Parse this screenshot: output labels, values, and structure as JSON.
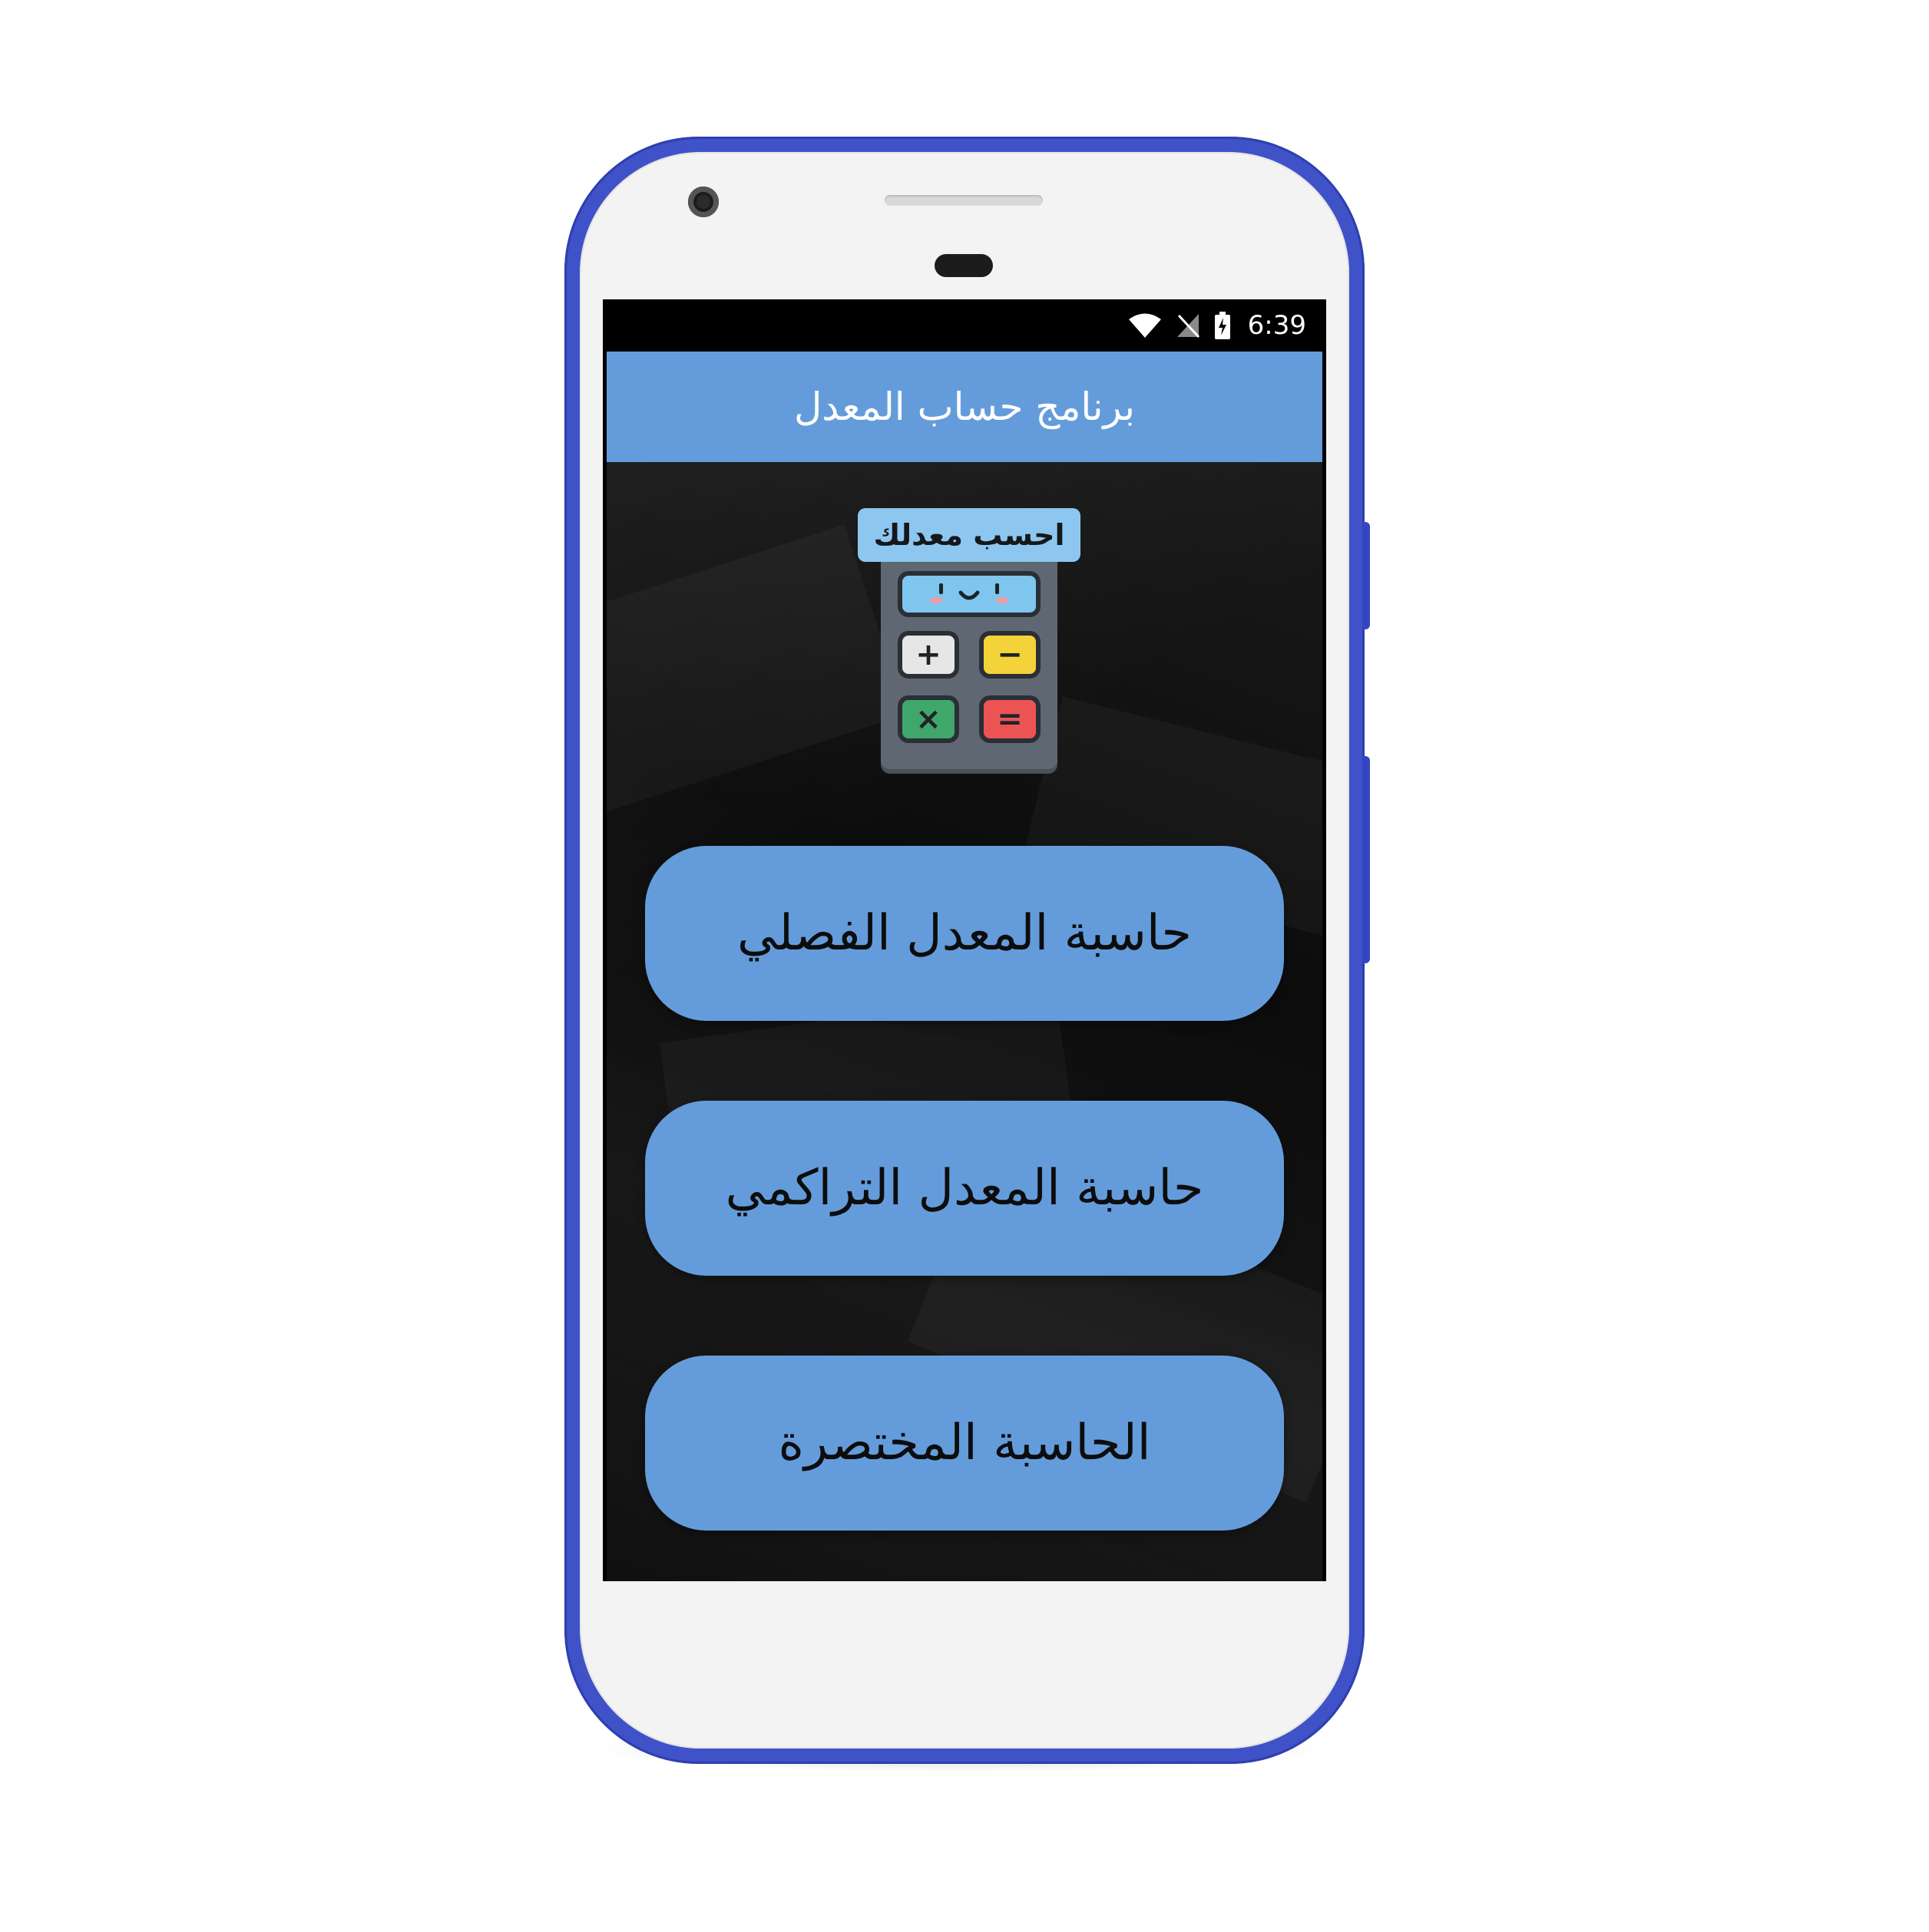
{
  "status_bar": {
    "time": "6:39",
    "icons": [
      "wifi-icon",
      "no-sim-icon",
      "battery-charging-icon"
    ]
  },
  "app_bar": {
    "title": "برنامج حساب المعدل"
  },
  "logo": {
    "label": "احسب معدلك",
    "keys": {
      "plus": "+",
      "minus": "−",
      "times": "×",
      "equals": "="
    }
  },
  "menu": {
    "semester_calculator": "حاسبة المعدل الفصلي",
    "cumulative_calculator": "حاسبة المعدل التراكمي",
    "short_calculator": "الحاسبة المختصرة"
  },
  "colors": {
    "phone_frame": "#3f52c8",
    "accent_blue": "#649cdb",
    "screen_background": "#000000"
  }
}
